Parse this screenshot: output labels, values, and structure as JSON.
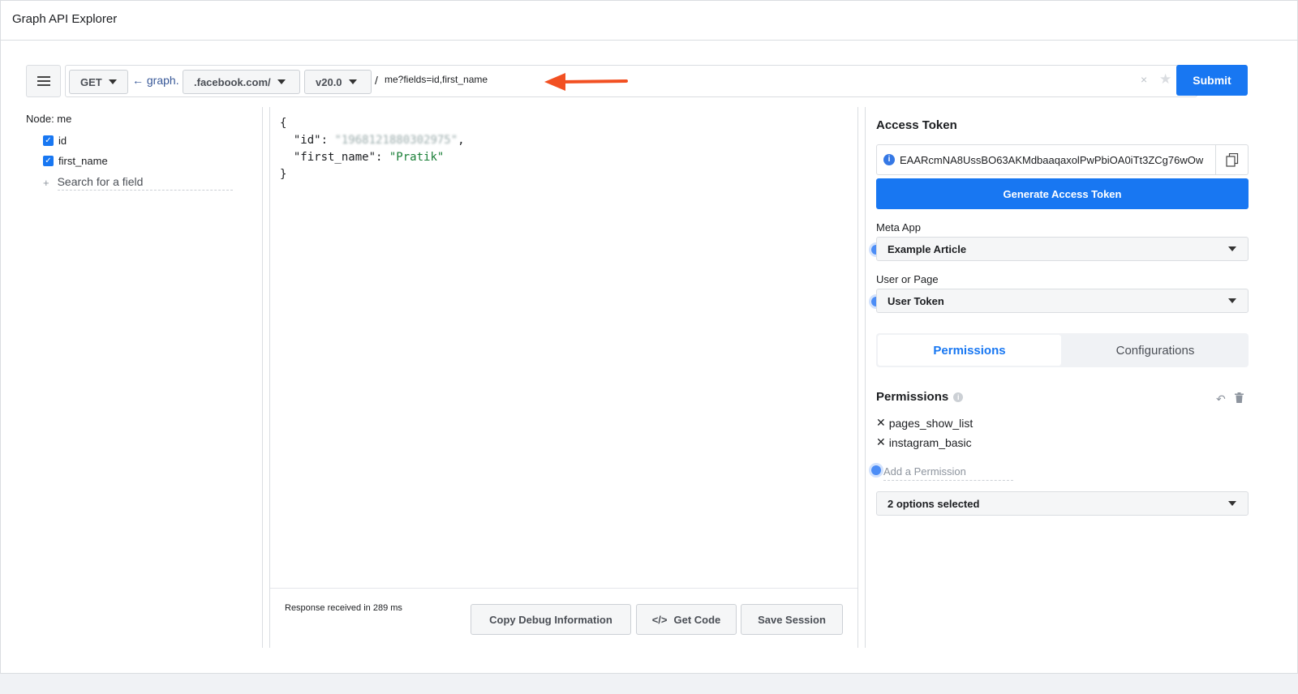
{
  "app": {
    "title": "Graph API Explorer"
  },
  "urlbar": {
    "method": "GET",
    "host_prefix": "← graph.",
    "host": ".facebook.com/",
    "version": "v20.0",
    "separator": "/",
    "path": "me?fields=id,first_name",
    "clear_symbol": "×",
    "star_symbol": "★",
    "submit_label": "Submit",
    "annotation_arrow_color": "#f25022"
  },
  "fields_panel": {
    "node_label": "Node:  me",
    "fields": [
      {
        "label": "id",
        "checked": true
      },
      {
        "label": "first_name",
        "checked": true
      }
    ],
    "search_placeholder": "Search for a field"
  },
  "response": {
    "open_brace": "{",
    "id_key": "\"id\": ",
    "id_value": "\"1968121880302975\"",
    "comma": ",",
    "first_name_key": "\"first_name\": ",
    "first_name_value": "\"Pratik\"",
    "close_brace": "}",
    "status_text": "Response received in 289 ms",
    "buttons": {
      "copy_debug": "Copy Debug Information",
      "get_code": "Get Code",
      "get_code_icon": "</>",
      "save_session": "Save Session"
    }
  },
  "token_panel": {
    "title": "Access Token",
    "token_value": "EAARcmNA8UssBO63AKMdbaaqaxolPwPbiOA0iTt3ZCg76wOw",
    "generate_label": "Generate Access Token",
    "meta_app_label": "Meta App",
    "meta_app_value": "Example Article",
    "user_page_label": "User or Page",
    "user_page_value": "User Token",
    "tabs": {
      "permissions": "Permissions",
      "configurations": "Configurations"
    },
    "permissions_title": "Permissions",
    "permissions": [
      "pages_show_list",
      "instagram_basic"
    ],
    "add_permission_placeholder": "Add a Permission",
    "options_selected": "2 options selected"
  },
  "colors": {
    "primary": "#1877f2",
    "border": "#dadde1",
    "accent_dot": "#4c8df6"
  }
}
